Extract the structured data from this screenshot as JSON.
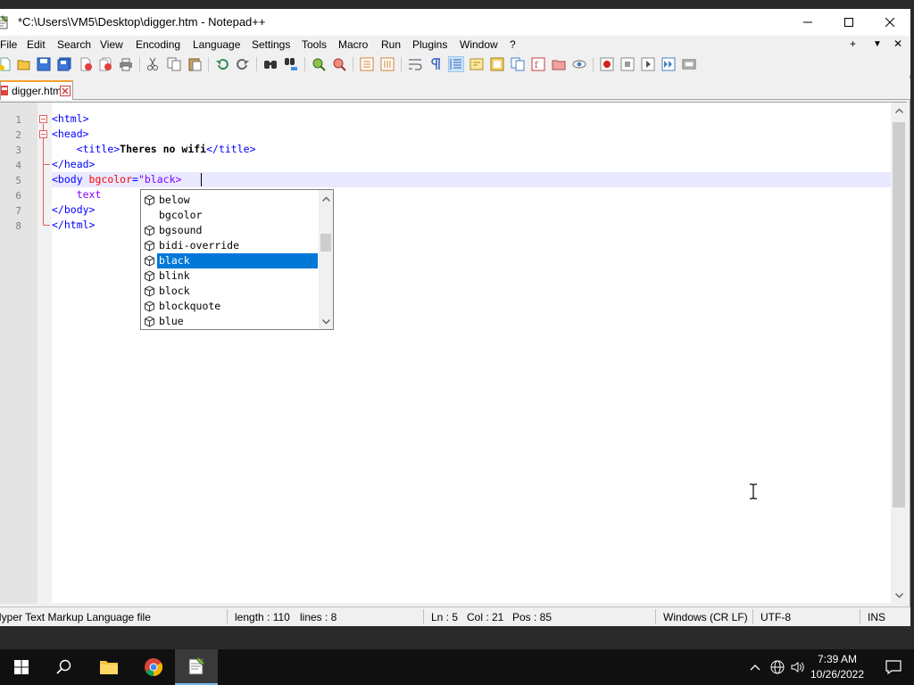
{
  "window": {
    "title": "*C:\\Users\\VM5\\Desktop\\digger.htm - Notepad++"
  },
  "menu": {
    "items": [
      "File",
      "Edit",
      "Search",
      "View",
      "Encoding",
      "Language",
      "Settings",
      "Tools",
      "Macro",
      "Run",
      "Plugins",
      "Window",
      "?"
    ],
    "right": [
      "+",
      "▼",
      "✕"
    ]
  },
  "toolbar": {
    "icons": [
      "new-file-icon",
      "open-file-icon",
      "save-icon",
      "save-all-icon",
      "close-icon",
      "close-all-icon",
      "print-icon",
      "cut-icon",
      "copy-icon",
      "paste-icon",
      "undo-icon",
      "redo-icon",
      "find-icon",
      "replace-icon",
      "zoom-in-icon",
      "zoom-out-icon",
      "sync-vertical-icon",
      "sync-horizontal-icon",
      "word-wrap-icon",
      "show-all-characters-icon",
      "indent-guide-icon",
      "user-defined-language-icon",
      "document-map-icon",
      "document-list-icon",
      "function-list-icon",
      "folder-as-workspace-icon",
      "monitoring-icon",
      "record-macro-icon",
      "stop-recording-icon",
      "playback-macro-icon",
      "run-macro-multiple-icon",
      "save-macro-icon"
    ]
  },
  "tabs": [
    {
      "label": "digger.htm"
    }
  ],
  "editor": {
    "line_numbers": [
      "1",
      "2",
      "3",
      "4",
      "5",
      "6",
      "7",
      "8"
    ],
    "lines": [
      {
        "indent": "",
        "parts": [
          [
            "tag",
            "<html>"
          ]
        ]
      },
      {
        "indent": "",
        "parts": [
          [
            "tag",
            "<head>"
          ]
        ]
      },
      {
        "indent": "    ",
        "parts": [
          [
            "tag",
            "<title>"
          ],
          [
            "txt",
            "Theres no wifi"
          ],
          [
            "tag",
            "</title>"
          ]
        ]
      },
      {
        "indent": "",
        "parts": [
          [
            "tag",
            "</head>"
          ]
        ]
      },
      {
        "indent": "",
        "parts": [
          [
            "tag",
            "<body "
          ],
          [
            "attr",
            "bgcolor"
          ],
          [
            "tag",
            "="
          ],
          [
            "str",
            "\"black>"
          ]
        ]
      },
      {
        "indent": "    ",
        "parts": [
          [
            "str",
            "text"
          ]
        ]
      },
      {
        "indent": "",
        "parts": [
          [
            "tag",
            "</body>"
          ]
        ]
      },
      {
        "indent": "",
        "parts": [
          [
            "tag",
            "</html>"
          ]
        ]
      }
    ],
    "current_line": 5
  },
  "autocomplete": {
    "items": [
      {
        "label": "below",
        "icon": true
      },
      {
        "label": "bgcolor",
        "icon": false
      },
      {
        "label": "bgsound",
        "icon": true
      },
      {
        "label": "bidi-override",
        "icon": true
      },
      {
        "label": "black",
        "icon": true,
        "selected": true
      },
      {
        "label": "blink",
        "icon": true
      },
      {
        "label": "block",
        "icon": true
      },
      {
        "label": "blockquote",
        "icon": true
      },
      {
        "label": "blue",
        "icon": true
      }
    ]
  },
  "status": {
    "file_type": "Hyper Text Markup Language file",
    "length": "length : 110",
    "lines": "lines : 8",
    "ln": "Ln : 5",
    "col": "Col : 21",
    "pos": "Pos : 85",
    "eol": "Windows (CR LF)",
    "encoding": "UTF-8",
    "mode": "INS"
  },
  "taskbar": {
    "time": "7:39 AM",
    "date": "10/26/2022"
  },
  "colors": {
    "tag": "#0000ff",
    "attribute": "#ff0000",
    "string": "#8000ff",
    "selection": "#0078d7",
    "tab_accent": "#f4a030"
  }
}
